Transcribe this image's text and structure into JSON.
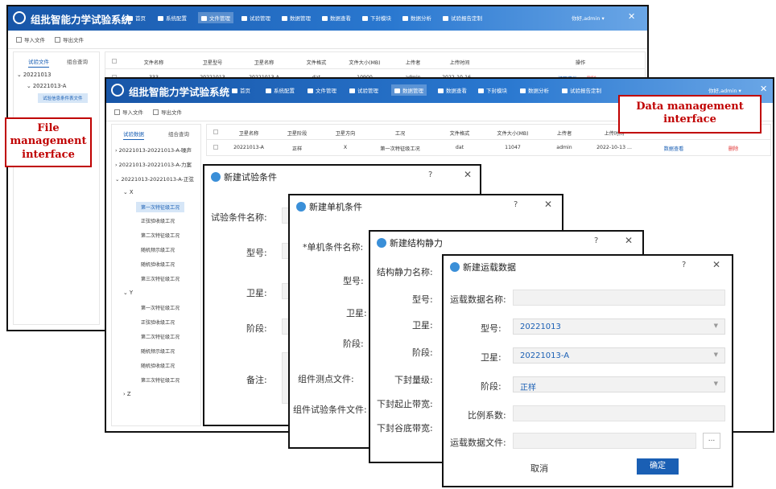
{
  "app": {
    "title": "组批智能力学试验系统",
    "nav": [
      "首页",
      "系统配置",
      "文件管理",
      "试验管理",
      "数据管理",
      "数据查看",
      "下封模块",
      "数据分析",
      "试验报告定制"
    ],
    "user": "你好,admin ▾",
    "close": "✕"
  },
  "toolbar": {
    "import": "导入文件",
    "export": "导出文件"
  },
  "file_window": {
    "sidebar_tabs": [
      "试验文件",
      "组合查询"
    ],
    "tree": [
      "20221013",
      "20221013-A",
      "试验信息条件表文件"
    ],
    "columns": [
      "文件名称",
      "卫星型号",
      "卫星名称",
      "文件格式",
      "文件大小(MB)",
      "上传者",
      "上传时间",
      "操作"
    ],
    "row": [
      "333",
      "20221013",
      "20221013-A",
      "dat",
      "10900",
      "admin",
      "2022-10-16 ...",
      "打开文件",
      "删除"
    ]
  },
  "data_window": {
    "sidebar_tabs": [
      "试验数据",
      "组合查询"
    ],
    "tree_top": [
      "20221013-20221013-A-噪声",
      "20221013-20221013-A-力案",
      "20221013-20221013-A-正弦"
    ],
    "x_label": "X",
    "x_items": [
      "第一次特征级工况",
      "正弦验收级工况",
      "第二次特征级工况",
      "随机频示级工况",
      "随机验收级工况",
      "第三次特征级工况"
    ],
    "y_label": "Y",
    "y_items": [
      "第一次特征级工况",
      "正弦验收级工况",
      "第二次特征级工况",
      "随机频示级工况",
      "随机验收级工况",
      "第三次特征级工况"
    ],
    "z_label": "Z",
    "columns": [
      "卫星名称",
      "卫星阶段",
      "卫星方向",
      "工况",
      "文件格式",
      "文件大小(MB)",
      "上传者",
      "上传时间"
    ],
    "row": [
      "20221013-A",
      "正样",
      "X",
      "第一次特征级工况",
      "dat",
      "11047",
      "admin",
      "2022-10-13 ...",
      "数据查看",
      "删除"
    ]
  },
  "callouts": {
    "file": "File management interface",
    "data": "Data management interface"
  },
  "dialog1": {
    "title": "新建试验条件",
    "labels": [
      "试验条件名称:",
      "型号:",
      "卫星:",
      "阶段:",
      "备注:"
    ]
  },
  "dialog2": {
    "title": "新建单机条件",
    "labels": [
      "*单机条件名称:",
      "型号:",
      "卫星:",
      "阶段:",
      "组件测点文件:",
      "组件试验条件文件:"
    ]
  },
  "dialog3": {
    "title": "新建结构静力",
    "labels": [
      "结构静力名称:",
      "型号:",
      "卫星:",
      "阶段:",
      "下封量级:",
      "下封起止带宽:",
      "下封谷底带宽:"
    ]
  },
  "dialog4": {
    "title": "新建运载数据",
    "labels": [
      "运载数据名称:",
      "型号:",
      "卫星:",
      "阶段:",
      "比例系数:",
      "运载数据文件:"
    ],
    "model_value": "20221013",
    "satellite_value": "20221013-A",
    "stage_value": "正样",
    "browse": "...",
    "cancel": "取消",
    "ok": "确定"
  },
  "dialog_help": "?",
  "dialog_close": "✕",
  "colors": {
    "topbar": "#1a5fb4",
    "accent": "#1a5fb4",
    "callout": "#c00000",
    "delete": "#e03030"
  }
}
